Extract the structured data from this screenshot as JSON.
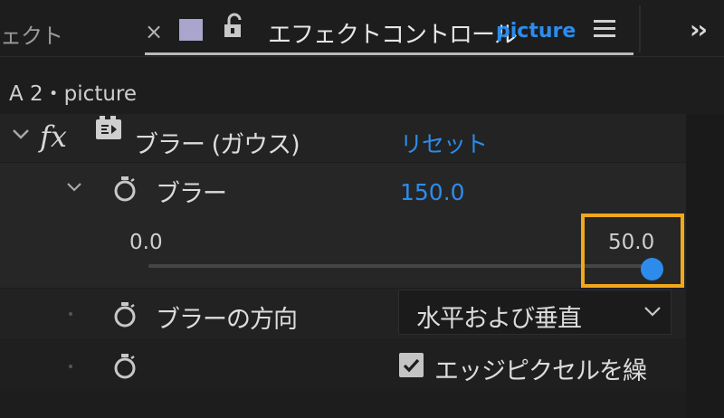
{
  "tabs": {
    "previous_tab_label": "ェクト",
    "close_glyph": "×",
    "active_title": "エフェクトコントロール",
    "active_clip": "picture",
    "label_color": "#a9a5cc"
  },
  "clip_label": "A 2・picture",
  "effect": {
    "fx_label": "fx",
    "name": "ブラー (ガウス)",
    "reset_label": "リセット"
  },
  "properties": {
    "blur": {
      "name": "ブラー",
      "value": "150.0",
      "slider_min": "0.0",
      "slider_max": "50.0",
      "slider_fraction": 1.0
    },
    "blur_direction": {
      "name": "ブラーの方向",
      "selected": "水平および垂直"
    },
    "repeat_edge_pixels": {
      "label": "エッジピクセルを繰",
      "checked": true
    }
  },
  "colors": {
    "accent_blue": "#2d8ceb",
    "highlight_orange": "#f2a81d"
  }
}
